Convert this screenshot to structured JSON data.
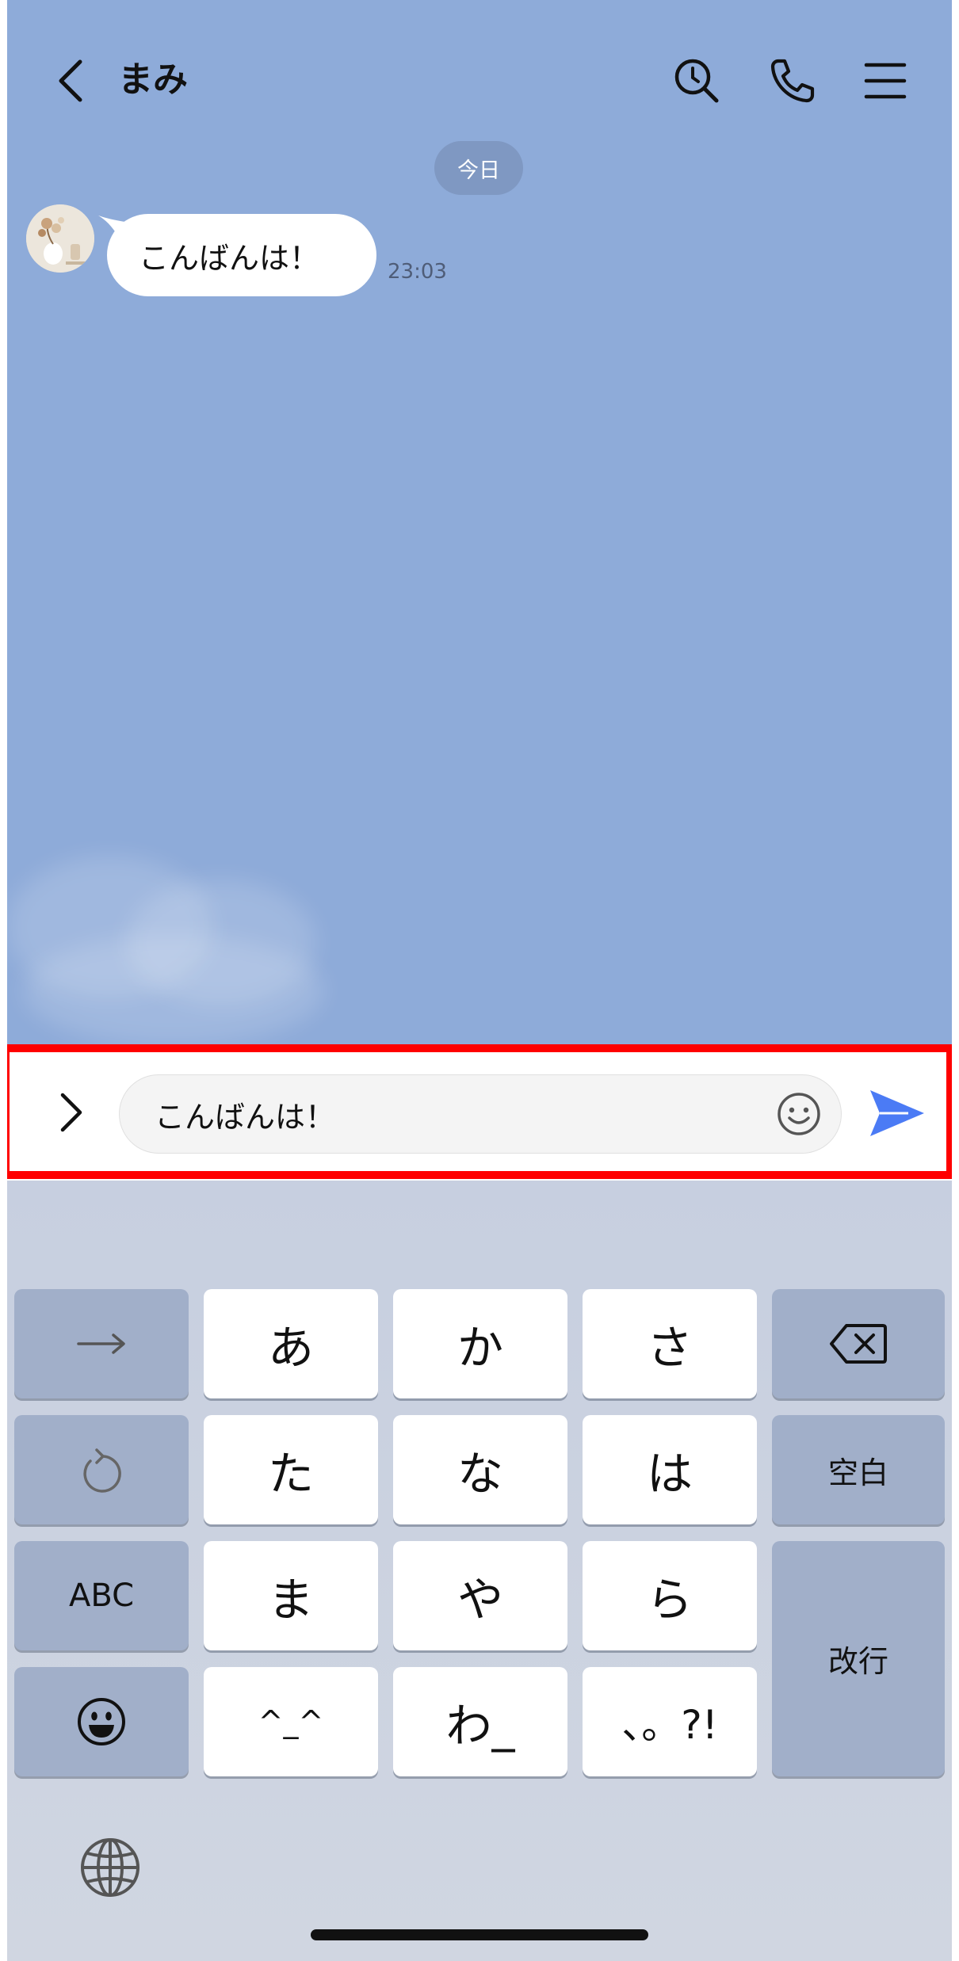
{
  "header": {
    "title": "まみ",
    "back_icon": "chevron-left-icon",
    "search_icon": "search-icon",
    "call_icon": "phone-icon",
    "menu_icon": "menu-icon"
  },
  "chat": {
    "date_label": "今日",
    "messages": [
      {
        "text": "こんばんは！",
        "time": "23:03"
      }
    ]
  },
  "input_bar": {
    "value": "こんばんは！",
    "expand_icon": "chevron-right-icon",
    "emoji_icon": "smiley-icon",
    "send_icon": "send-icon",
    "send_color": "#4b7bf5"
  },
  "keyboard": {
    "rows": [
      [
        "→",
        "あ",
        "か",
        "さ",
        "⌫"
      ],
      [
        "↺",
        "た",
        "な",
        "は",
        "空白"
      ],
      [
        "ABC",
        "ま",
        "や",
        "ら",
        "改行"
      ],
      [
        "☺",
        "^_^",
        "わ_",
        "、。?!"
      ]
    ],
    "globe_icon": "globe-icon"
  },
  "colors": {
    "chat_background": "#8eabd9",
    "highlight_border": "#ff0000"
  }
}
